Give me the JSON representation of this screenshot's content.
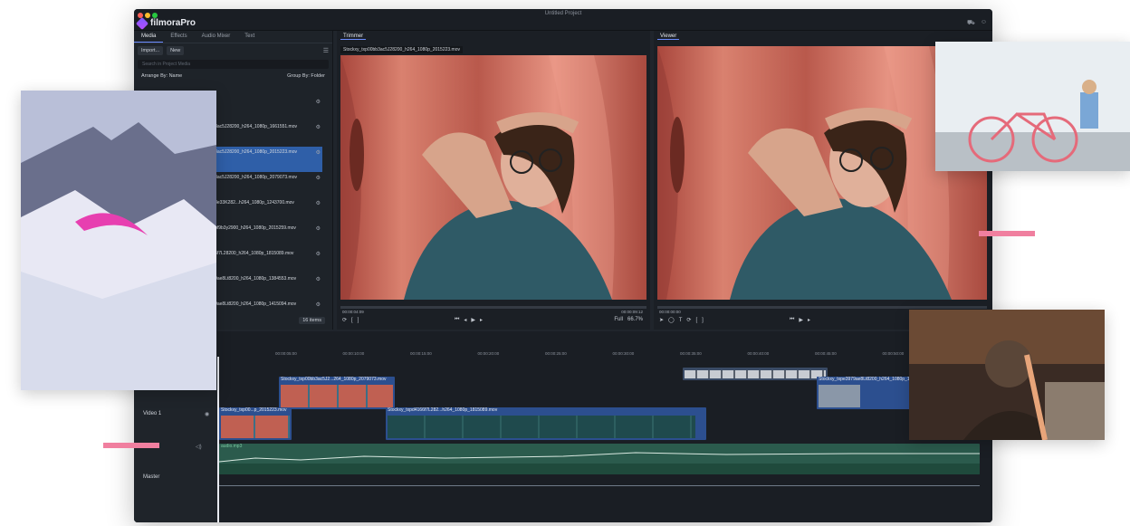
{
  "window": {
    "title": "Untitled Project",
    "brand": "filmoraPro"
  },
  "media_panel": {
    "tabs": [
      {
        "label": "Media",
        "active": true
      },
      {
        "label": "Effects",
        "active": false
      },
      {
        "label": "Audio Mixer",
        "active": false
      },
      {
        "label": "Text",
        "active": false
      }
    ],
    "import_label": "Import...",
    "new_label": "New",
    "search_placeholder": "Search in Project Media",
    "arrange_label": "Arrange By: Name",
    "group_label": "Group By: Folder",
    "items": [
      {
        "name": "audio.mp3",
        "info": "stereo @ 48000Hz",
        "selected": false
      },
      {
        "name": "Stockxy_txp00bb3ac5J28200_h264_1080p_1661551.mov",
        "info": "23.976fps",
        "selected": false
      },
      {
        "name": "Stockxy_txp00bb3ac5J28200_h264_1080p_2015223.mov",
        "info": "23.976fps",
        "selected": true
      },
      {
        "name": "Stockxy_txp00bb3ac5J28200_h264_1080p_2079073.mov",
        "info": "23.976fps",
        "selected": false
      },
      {
        "name": "Stockxy_txp73648e33K282...h264_1080p_1243700.mov",
        "info": "29.97fps",
        "selected": false
      },
      {
        "name": "Stockxy_txp7814bf9b3y2900_h264_1080p_2015259.mov",
        "info": "25fps",
        "selected": false
      },
      {
        "name": "Stockxy_txpd4166f7L28200_h264_1080p_1815089.mov",
        "info": "23.976fps",
        "selected": false
      },
      {
        "name": "Stockxy_txpe3979ae8Lt8200_h264_1080p_1384553.mov",
        "info": "23.976fps",
        "selected": false
      },
      {
        "name": "Stockxy_txpe3979ae8Lt8200_h264_1080p_1415094.mov",
        "info": "23.976fps",
        "selected": false
      }
    ],
    "item_count": "16 items"
  },
  "trimmer": {
    "tab": "Trimmer",
    "file": "Stockxy_txp00bb3ac5J28200_h264_1080p_2015223.mov",
    "timecode": "00:00:04:09",
    "end_timecode": "00:00:09:12",
    "quality": "Full",
    "zoom": "66.7%"
  },
  "viewer": {
    "tab": "Viewer",
    "timecode": "00:00:00:00",
    "end_timecode": "00:00:55:00"
  },
  "timeline": {
    "ruler": [
      "00:00:05:00",
      "00:00:10:00",
      "00:00:15:00",
      "00:00:20:00",
      "00:00:25:00",
      "00:00:30:00",
      "00:00:35:00",
      "00:00:40:00",
      "00:00:45:00",
      "00:00:50:00"
    ],
    "tracks": {
      "video1": "Video 1",
      "master": "Master"
    },
    "clips": [
      {
        "label": "Stockxy_txp00bb3ac5J2...264_1080p_2079073.mov"
      },
      {
        "label": "Stockxy_txpe3979ae8Lt8200_h264_1080p_1"
      },
      {
        "label": "Stockxy_txp00...p_2015223.mov"
      },
      {
        "label": "Stockxy_txpd4166f7L282...h264_1080p_1815089.mov"
      },
      {
        "label": "audio.mp3"
      }
    ]
  },
  "colors": {
    "accent": "#6c8cff",
    "pink": "#f07f9f",
    "selection": "#2f5fa8"
  }
}
